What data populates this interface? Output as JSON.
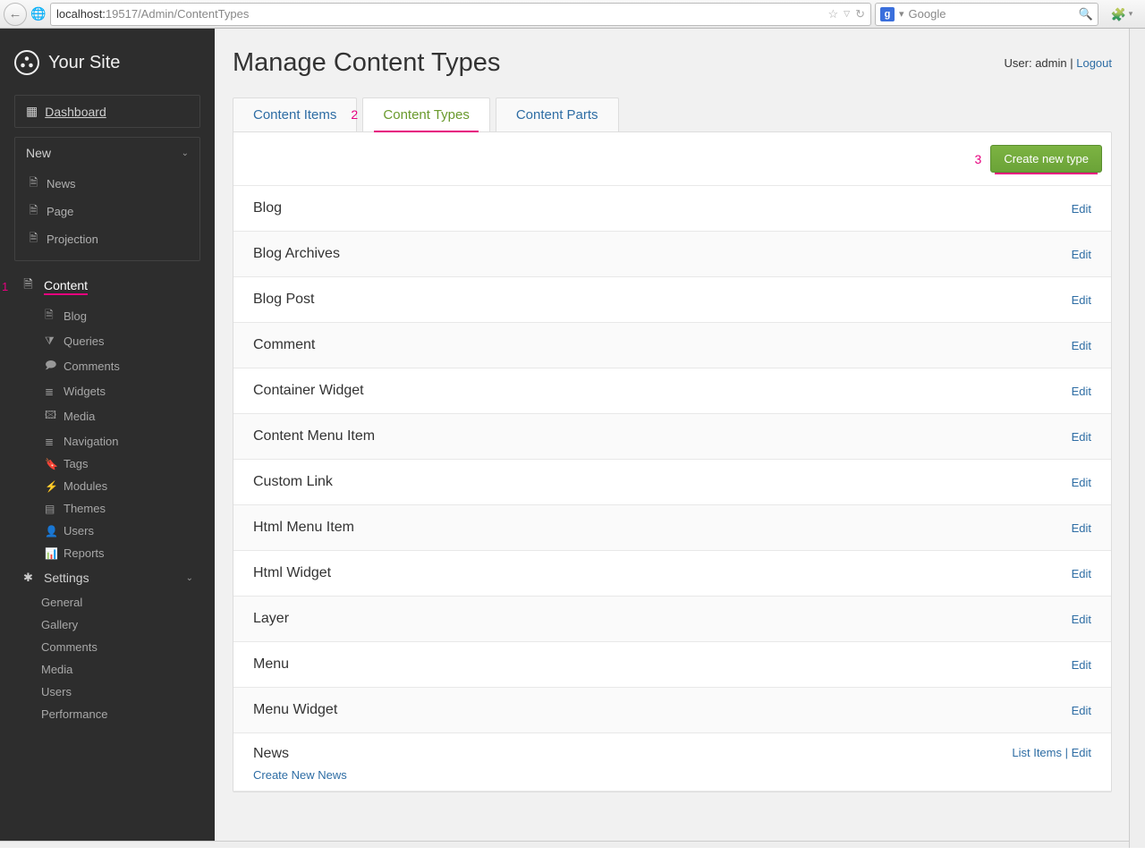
{
  "browser": {
    "url_host": "localhost:",
    "url_port_path": "19517/Admin/ContentTypes",
    "search_placeholder": "Google"
  },
  "brand": "Your Site",
  "sidebar": {
    "dashboard": "Dashboard",
    "new_label": "New",
    "new_items": [
      "News",
      "Page",
      "Projection"
    ],
    "content": "Content",
    "content_children": [
      {
        "icon": "file",
        "label": "Blog"
      },
      {
        "icon": "filter",
        "label": "Queries"
      },
      {
        "icon": "comment",
        "label": "Comments"
      },
      {
        "icon": "list",
        "label": "Widgets"
      },
      {
        "icon": "image",
        "label": "Media"
      },
      {
        "icon": "list",
        "label": "Navigation"
      },
      {
        "icon": "tag",
        "label": "Tags"
      },
      {
        "icon": "plug",
        "label": "Modules"
      },
      {
        "icon": "theme",
        "label": "Themes"
      },
      {
        "icon": "user",
        "label": "Users"
      },
      {
        "icon": "chart",
        "label": "Reports"
      }
    ],
    "settings": "Settings",
    "settings_children": [
      "General",
      "Gallery",
      "Comments",
      "Media",
      "Users",
      "Performance"
    ]
  },
  "annotations": {
    "one": "1",
    "two": "2",
    "three": "3"
  },
  "page": {
    "title": "Manage Content Types",
    "user_prefix": "User: ",
    "user_name": "admin",
    "sep": " | ",
    "logout": "Logout"
  },
  "tabs": [
    {
      "label": "Content Items",
      "active": false
    },
    {
      "label": "Content Types",
      "active": true
    },
    {
      "label": "Content Parts",
      "active": false
    }
  ],
  "create_button": "Create new type",
  "edit_label": "Edit",
  "list_items_label": "List Items",
  "types": [
    {
      "name": "Blog"
    },
    {
      "name": "Blog Archives"
    },
    {
      "name": "Blog Post"
    },
    {
      "name": "Comment"
    },
    {
      "name": "Container Widget"
    },
    {
      "name": "Content Menu Item"
    },
    {
      "name": "Custom Link"
    },
    {
      "name": "Html Menu Item"
    },
    {
      "name": "Html Widget"
    },
    {
      "name": "Layer"
    },
    {
      "name": "Menu"
    },
    {
      "name": "Menu Widget"
    },
    {
      "name": "News",
      "create_sub": "Create New News",
      "has_list": true
    }
  ],
  "icons": {
    "dashboard": "▦",
    "file": "🗎",
    "list": "≣",
    "filter": "⧩",
    "comment": "🗩",
    "image": "🖾",
    "tag": "🔖",
    "plug": "⚡",
    "theme": "▤",
    "user": "👤",
    "chart": "📊",
    "gear": "✱"
  }
}
